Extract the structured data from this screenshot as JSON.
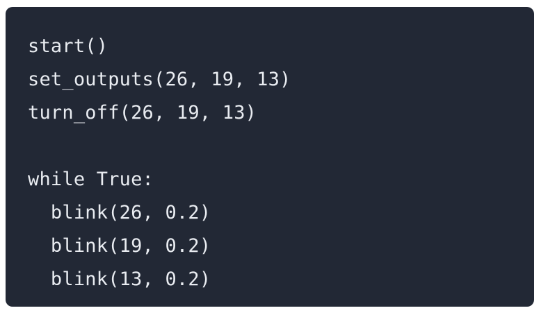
{
  "code": {
    "lines": [
      "start()",
      "set_outputs(26, 19, 13)",
      "turn_off(26, 19, 13)",
      "",
      "while True:",
      "  blink(26, 0.2)",
      "  blink(19, 0.2)",
      "  blink(13, 0.2)"
    ]
  },
  "colors": {
    "background": "#222835",
    "text": "#e9ecf1"
  }
}
